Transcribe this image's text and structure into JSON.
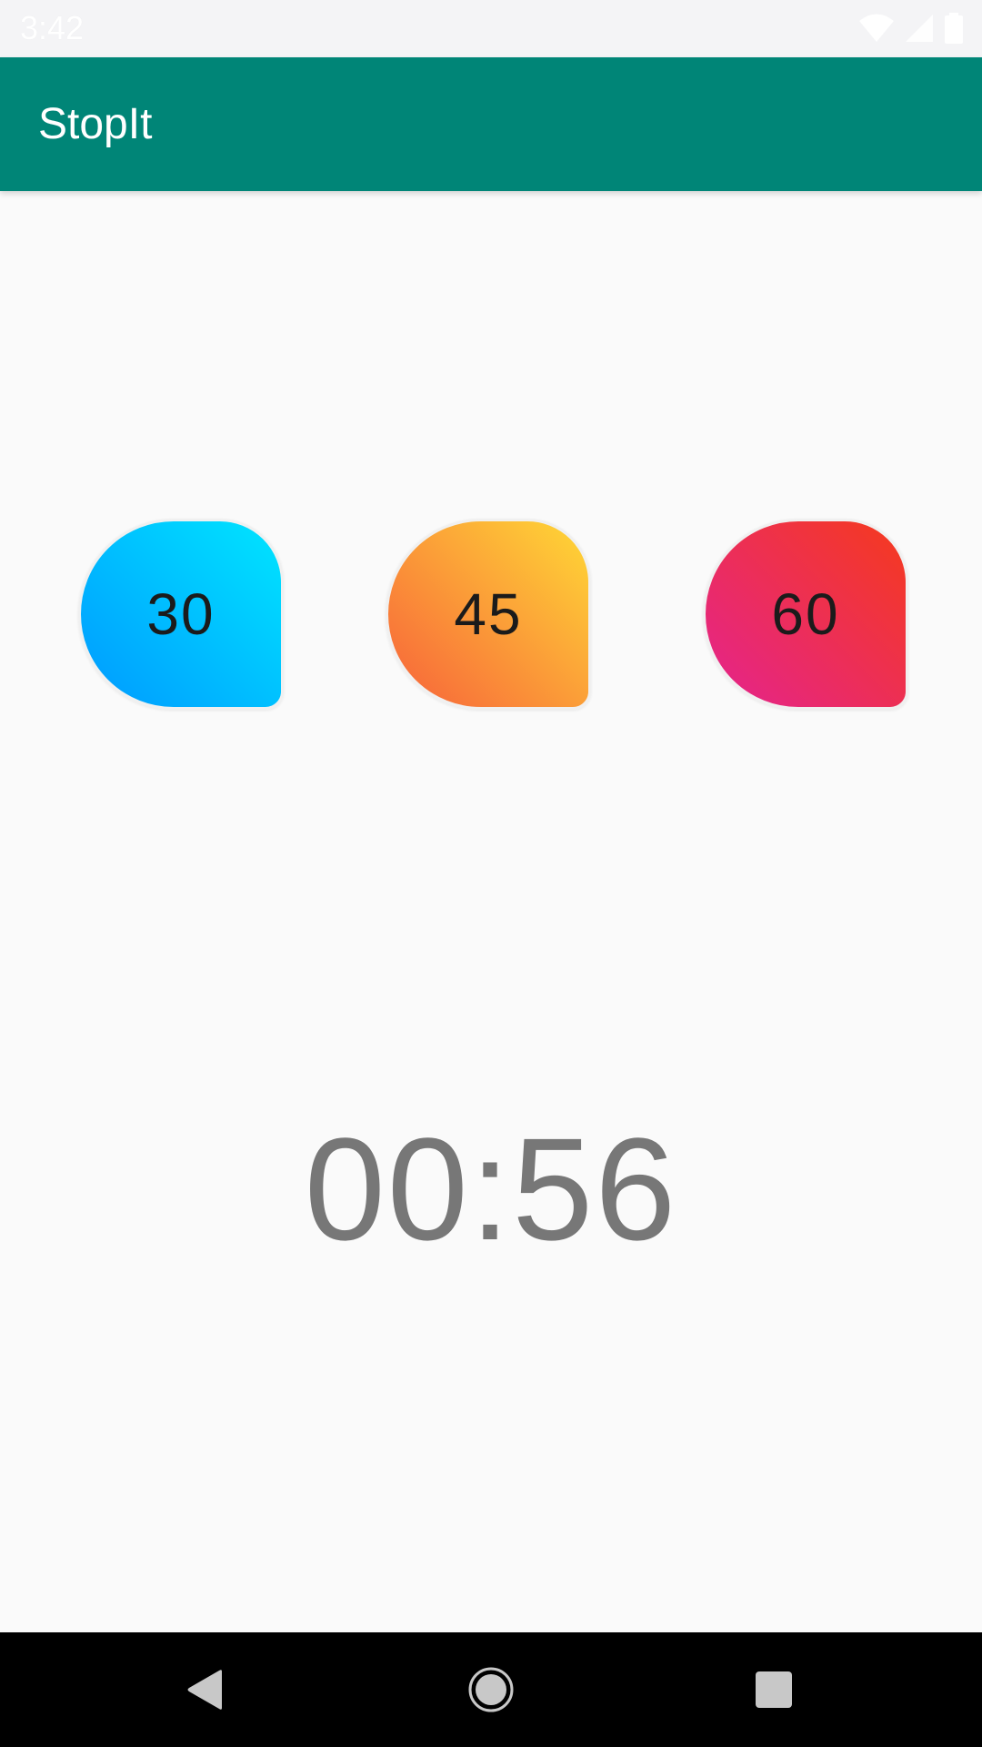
{
  "status_bar": {
    "time": "3:42",
    "icons": [
      "wifi-icon",
      "signal-icon",
      "battery-icon"
    ]
  },
  "app_bar": {
    "title": "StopIt",
    "color": "#008577"
  },
  "timer_buttons": [
    {
      "label": "30",
      "gradient": [
        "#00e5ff",
        "#0099ff"
      ]
    },
    {
      "label": "45",
      "gradient": [
        "#ffd836",
        "#f7613a"
      ]
    },
    {
      "label": "60",
      "gradient": [
        "#f53a1c",
        "#e4238f"
      ]
    }
  ],
  "timer": {
    "display": "00:56"
  },
  "nav_bar": {
    "icons": [
      "back-icon",
      "home-icon",
      "recents-icon"
    ]
  }
}
